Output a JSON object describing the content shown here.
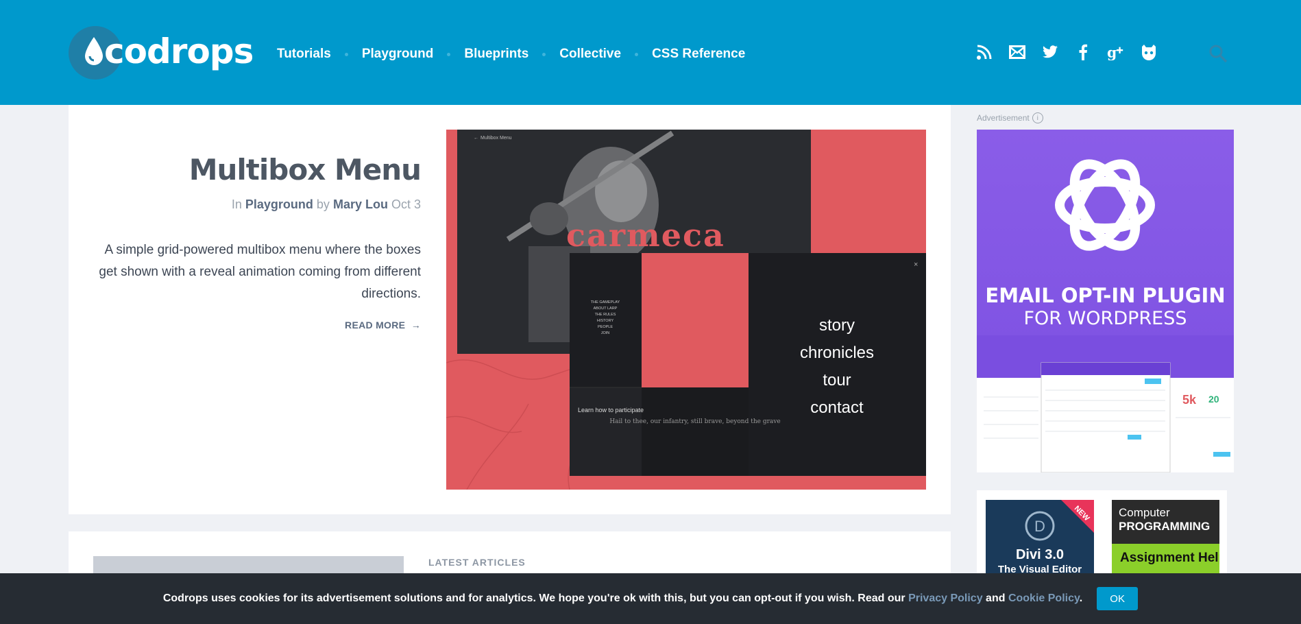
{
  "header": {
    "logo_text": "codrops",
    "nav": [
      {
        "label": "Tutorials"
      },
      {
        "label": "Playground"
      },
      {
        "label": "Blueprints"
      },
      {
        "label": "Collective"
      },
      {
        "label": "CSS Reference"
      }
    ],
    "social_icons": [
      "rss-icon",
      "mail-icon",
      "twitter-icon",
      "facebook-icon",
      "google-plus-icon",
      "github-icon"
    ],
    "search_icon": "search-icon"
  },
  "feature": {
    "title": "Multibox Menu",
    "meta_in": "In",
    "category": "Playground",
    "meta_by": "by",
    "author": "Mary Lou",
    "date": "Oct 3",
    "description": "A simple grid-powered multibox menu where the boxes get shown with a reveal animation coming from different directions.",
    "read_more": "READ MORE",
    "image": {
      "brand": "carmeca",
      "top_title": "Multibox Menu",
      "menu_items": [
        "THE GAMEPLAY",
        "ABOUT LARP",
        "THE RULES",
        "HISTORY",
        "PEOPLE",
        "JOIN"
      ],
      "big_menu": [
        "story",
        "chronicles",
        "tour",
        "contact"
      ],
      "learn_text": "Learn how to participate",
      "quote": "Hail to thee, our infantry, still brave, beyond the grave"
    }
  },
  "latest": {
    "label": "LATEST ARTICLES"
  },
  "sidebar": {
    "ad_label": "Advertisement",
    "ad_info": "i",
    "ad_headline": "EMAIL OPT-IN PLUGIN",
    "ad_subheadline": "FOR WORDPRESS",
    "book1_badge": "NEW",
    "book1_title": "Divi 3.0",
    "book1_subtitle": "The Visual Editor",
    "book2_top": "Computer",
    "book2_mid": "PROGRAMMING",
    "book2_bottom": "Assignment Help"
  },
  "cookie": {
    "text": "Codrops uses cookies for its advertisement solutions and for analytics. We hope you're ok with this, but you can opt-out if you wish. Read our",
    "privacy": "Privacy Policy",
    "and": "and",
    "cookie_policy": "Cookie Policy",
    "period": ".",
    "ok": "OK"
  },
  "colors": {
    "header_bg": "#0099cc",
    "accent_red": "#e05a5f",
    "ad_purple": "#8a5de8",
    "cookie_bg": "#262c33"
  }
}
